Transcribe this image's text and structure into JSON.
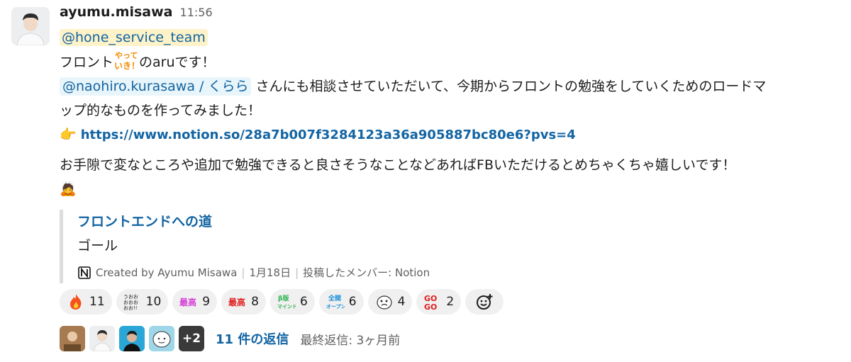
{
  "message": {
    "author": "ayumu.misawa",
    "time": "11:56",
    "mention_group": "@hone_service_team",
    "line1_pre": "フロント",
    "line1_post": "のaruです！",
    "sticker_top": "やって",
    "sticker_bottom": "いき！",
    "mention_user": "@naohiro.kurasawa / くらら",
    "line2_rest": " さんにも相談させていただいて、今期からフロントの勉強をしていくためのロードマ",
    "line3": "ップ的なものを作ってみました！",
    "link_emoji": "👉",
    "link": "https://www.notion.so/28a7b007f3284123a36a905887bc80e6?pvs=4",
    "line4": "お手隙で変なところや追加で勉強できると良さそうなことなどあればFBいただけるとめちゃくちゃ嬉しいです！",
    "bow_emoji": "🙇"
  },
  "unfurl": {
    "title": "フロントエンドへの道",
    "body": "ゴール",
    "created_by": "Created by Ayumu Misawa",
    "date": "1月18日",
    "poster": "投稿したメンバー: Notion"
  },
  "reactions": [
    {
      "icon": "fire-icon",
      "count": "11"
    },
    {
      "icon": "oooo-icon",
      "count": "10"
    },
    {
      "icon": "saikou-pink-icon",
      "count": "9"
    },
    {
      "icon": "saikou-red-icon",
      "count": "8"
    },
    {
      "icon": "beta-mind-icon",
      "count": "6"
    },
    {
      "icon": "zenkai-open-icon",
      "count": "6"
    },
    {
      "icon": "thinking-face-icon",
      "count": "4"
    },
    {
      "icon": "gogo-icon",
      "count": "2"
    }
  ],
  "thread": {
    "more": "+2",
    "replies": "11 件の返信",
    "last_reply": "最終返信: 3ヶ月前"
  },
  "colors": {
    "link": "#1264a3",
    "mention_bg": "#fdf2c8",
    "user_mention_bg": "#e8f5fa",
    "reaction_bg": "#f0f0f0"
  }
}
